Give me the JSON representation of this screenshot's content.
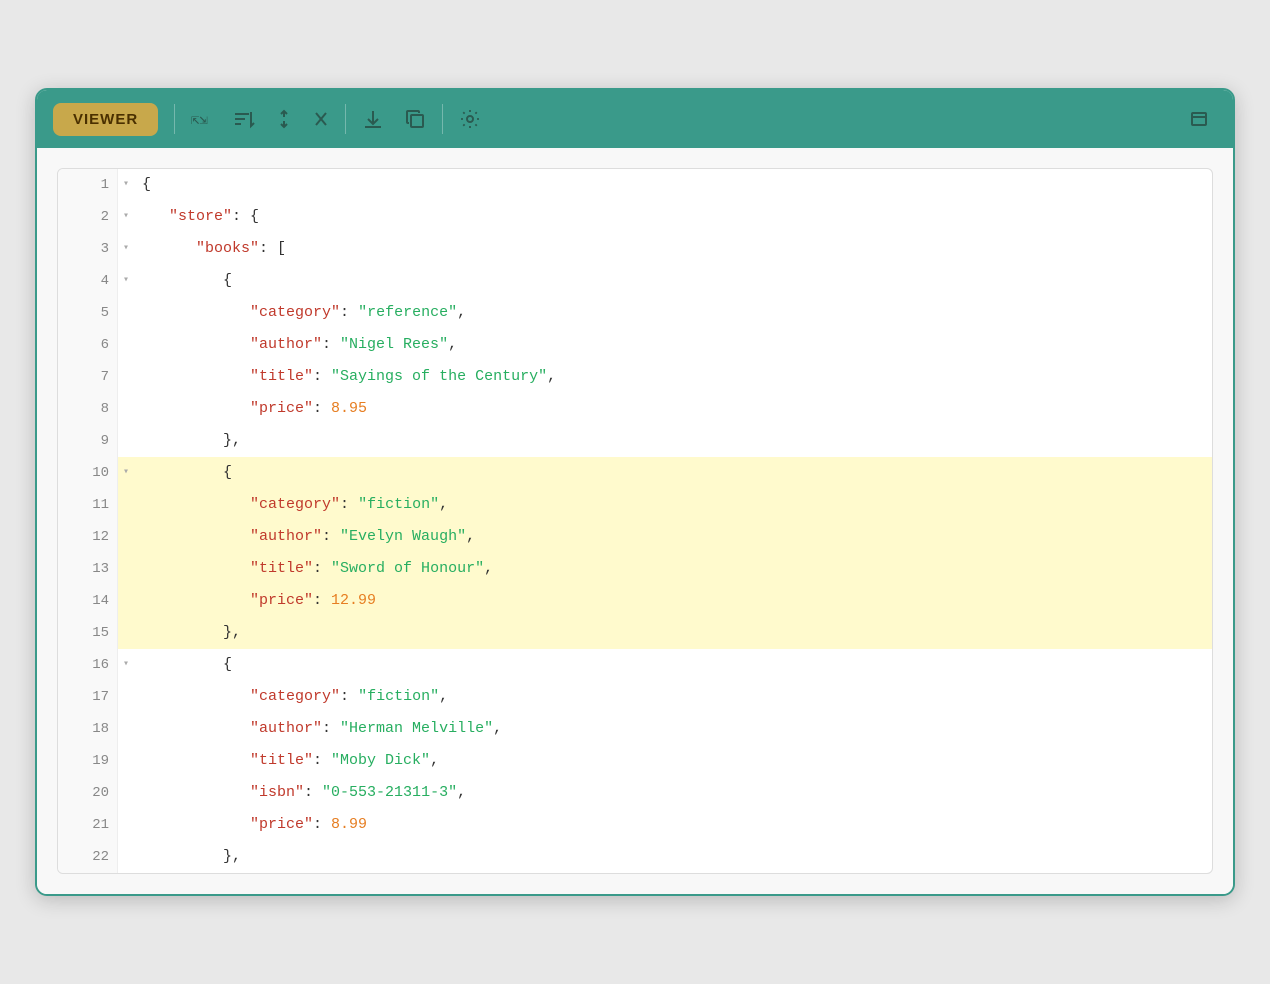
{
  "toolbar": {
    "brand": "VIEWER",
    "buttons": [
      {
        "name": "collapse-all",
        "icon": "⇱⇲",
        "label": "Collapse All"
      },
      {
        "name": "sort",
        "icon": "≡↑",
        "label": "Sort"
      },
      {
        "name": "expand-collapse",
        "icon": "⇅",
        "label": "Expand/Collapse"
      },
      {
        "name": "minimize",
        "icon": "×",
        "label": "Minimize"
      },
      {
        "name": "download",
        "icon": "⬇",
        "label": "Download"
      },
      {
        "name": "copy",
        "icon": "⧉",
        "label": "Copy"
      },
      {
        "name": "settings",
        "icon": "⚙",
        "label": "Settings"
      }
    ]
  },
  "window": {
    "restore_icon": "▣"
  },
  "lines": [
    {
      "num": 1,
      "collapse": "▾",
      "content": "{",
      "highlighted": false
    },
    {
      "num": 2,
      "collapse": "▾",
      "highlighted": false
    },
    {
      "num": 3,
      "collapse": "▾",
      "highlighted": false
    },
    {
      "num": 4,
      "collapse": "▾",
      "highlighted": false
    },
    {
      "num": 5,
      "collapse": null,
      "highlighted": false
    },
    {
      "num": 6,
      "collapse": null,
      "highlighted": false
    },
    {
      "num": 7,
      "collapse": null,
      "highlighted": false
    },
    {
      "num": 8,
      "collapse": null,
      "highlighted": false
    },
    {
      "num": 9,
      "collapse": null,
      "highlighted": false
    },
    {
      "num": 10,
      "collapse": "▾",
      "highlighted": true
    },
    {
      "num": 11,
      "collapse": null,
      "highlighted": true
    },
    {
      "num": 12,
      "collapse": null,
      "highlighted": true
    },
    {
      "num": 13,
      "collapse": null,
      "highlighted": true
    },
    {
      "num": 14,
      "collapse": null,
      "highlighted": true
    },
    {
      "num": 15,
      "collapse": null,
      "highlighted": true
    },
    {
      "num": 16,
      "collapse": "▾",
      "highlighted": false
    },
    {
      "num": 17,
      "collapse": null,
      "highlighted": false
    },
    {
      "num": 18,
      "collapse": null,
      "highlighted": false
    },
    {
      "num": 19,
      "collapse": null,
      "highlighted": false
    },
    {
      "num": 20,
      "collapse": null,
      "highlighted": false
    },
    {
      "num": 21,
      "collapse": null,
      "highlighted": false
    },
    {
      "num": 22,
      "collapse": null,
      "highlighted": false
    }
  ]
}
